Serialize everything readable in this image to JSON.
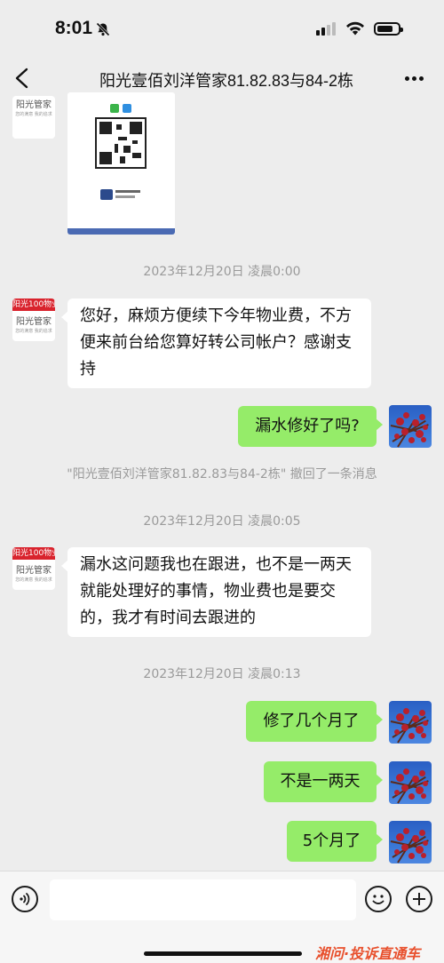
{
  "status_bar": {
    "time": "8:01",
    "battery_level": 0.75
  },
  "header": {
    "title": "阳光壹佰刘洋管家81.82.83与84-2栋"
  },
  "avatar_org": {
    "banner": "阳光100物业",
    "name": "阳光管家",
    "tagline": "您的满意 我的追求"
  },
  "messages": [
    {
      "type": "timestamp",
      "text": "2023年12月20日 凌晨0:00"
    },
    {
      "type": "incoming",
      "text": "您好，麻烦方便续下今年物业费，不方便来前台给您算好转公司帐户？感谢支持"
    },
    {
      "type": "outgoing",
      "text": "漏水修好了吗?"
    },
    {
      "type": "notice",
      "text": "\"阳光壹佰刘洋管家81.82.83与84-2栋\" 撤回了一条消息"
    },
    {
      "type": "timestamp",
      "text": "2023年12月20日 凌晨0:05"
    },
    {
      "type": "incoming",
      "text": "漏水这问题我也在跟进，也不是一两天就能处理好的事情，物业费也是要交的，我才有时间去跟进的"
    },
    {
      "type": "timestamp",
      "text": "2023年12月20日 凌晨0:13"
    },
    {
      "type": "outgoing",
      "text": "修了几个月了"
    },
    {
      "type": "outgoing",
      "text": "不是一两天"
    },
    {
      "type": "outgoing",
      "text": "5个月了"
    }
  ],
  "input": {
    "placeholder": ""
  },
  "watermark": "湘问·投诉直通车",
  "colors": {
    "outgoing_bubble": "#95ec69",
    "incoming_bubble": "#ffffff",
    "background": "#ededed",
    "org_red": "#d9232d"
  }
}
